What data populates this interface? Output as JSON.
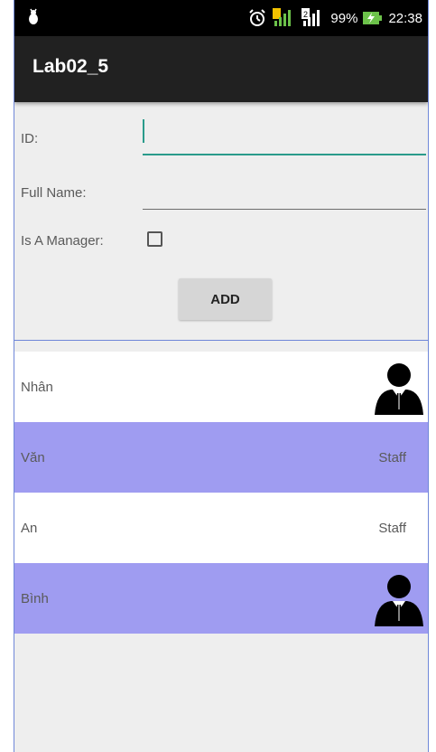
{
  "status_bar": {
    "battery": "99%",
    "time": "22:38",
    "icons": [
      "debug-bug-icon",
      "alarm-icon",
      "signal-icon",
      "signal-2-icon",
      "battery-charging-icon"
    ]
  },
  "app_bar": {
    "title": "Lab02_5"
  },
  "form": {
    "id_label": "ID:",
    "id_value": "",
    "fullname_label": "Full Name:",
    "fullname_value": "",
    "manager_label": "Is A Manager:",
    "manager_checked": false,
    "add_label": "ADD"
  },
  "employees": [
    {
      "name": "Nhân",
      "role": "",
      "icon": "manager-icon",
      "row_color": "white"
    },
    {
      "name": "Văn",
      "role": "Staff",
      "icon": "",
      "row_color": "purple"
    },
    {
      "name": "An",
      "role": "Staff",
      "icon": "",
      "row_color": "white"
    },
    {
      "name": "Bình",
      "role": "",
      "icon": "manager-icon",
      "row_color": "purple"
    }
  ],
  "colors": {
    "accent": "#2a9b8b",
    "row_highlight": "#9f9cf1",
    "app_bar": "#212121"
  }
}
